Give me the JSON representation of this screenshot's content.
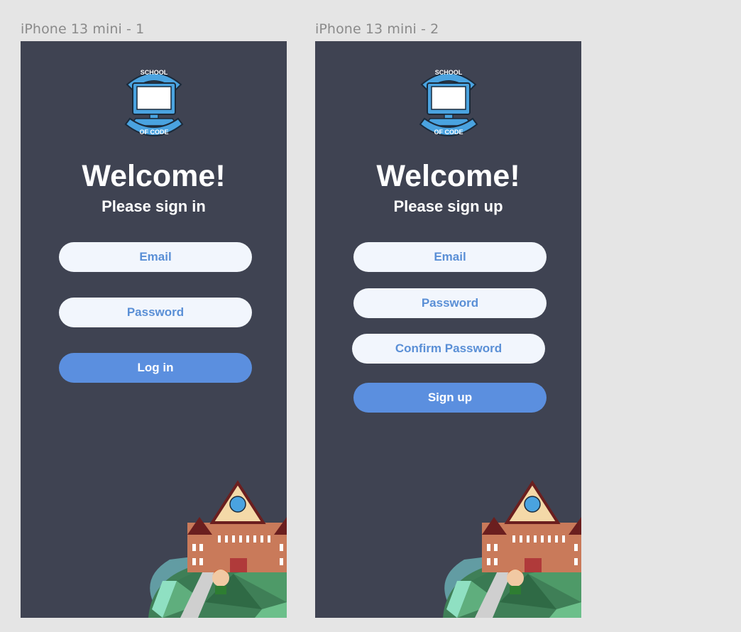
{
  "frames": [
    {
      "label": "iPhone 13 mini - 1",
      "welcome": "Welcome!",
      "subtitle": "Please sign in",
      "email_placeholder": "Email",
      "password_placeholder": "Password",
      "button_label": "Log in"
    },
    {
      "label": "iPhone 13 mini - 2",
      "welcome": "Welcome!",
      "subtitle": "Please sign up",
      "email_placeholder": "Email",
      "password_placeholder": "Password",
      "confirm_password_placeholder": "Confirm Password",
      "button_label": "Sign up"
    }
  ],
  "logo": {
    "top_text": "SCHOOL",
    "bottom_text": "OF CODE"
  },
  "colors": {
    "canvas_bg": "#e5e5e5",
    "frame_bg": "#3f4352",
    "field_bg": "#f2f6fd",
    "field_text": "#5a8fd6",
    "button_bg": "#5b8fdf",
    "button_text": "#ffffff",
    "logo_blue": "#4aa3e0",
    "hill_green": "#4f9a6a",
    "building_brick": "#c97a5a"
  },
  "icons": [
    "school-of-code-logo-icon",
    "school-building-illustration"
  ]
}
